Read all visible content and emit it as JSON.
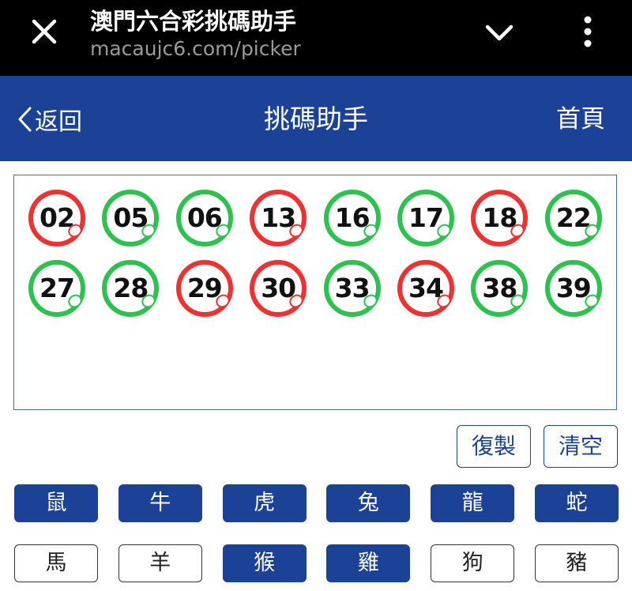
{
  "browser": {
    "title": "澳門六合彩挑碼助手",
    "url": "macaujc6.com/picker",
    "close_icon": "close-icon",
    "dropdown_icon": "chevron-down-icon",
    "menu_icon": "more-vertical-icon"
  },
  "header": {
    "back_label": "返回",
    "title": "挑碼助手",
    "home_label": "首頁",
    "color": "#1b4296"
  },
  "selected_numbers": [
    {
      "num": "02",
      "color": "red"
    },
    {
      "num": "05",
      "color": "green"
    },
    {
      "num": "06",
      "color": "green"
    },
    {
      "num": "13",
      "color": "red"
    },
    {
      "num": "16",
      "color": "green"
    },
    {
      "num": "17",
      "color": "green"
    },
    {
      "num": "18",
      "color": "red"
    },
    {
      "num": "22",
      "color": "green"
    },
    {
      "num": "27",
      "color": "green"
    },
    {
      "num": "28",
      "color": "green"
    },
    {
      "num": "29",
      "color": "red"
    },
    {
      "num": "30",
      "color": "red"
    },
    {
      "num": "33",
      "color": "green"
    },
    {
      "num": "34",
      "color": "red"
    },
    {
      "num": "38",
      "color": "green"
    },
    {
      "num": "39",
      "color": "green"
    }
  ],
  "ball_colors": {
    "red": "#ee3232",
    "green": "#2dc24e"
  },
  "actions": {
    "copy_label": "復製",
    "clear_label": "清空"
  },
  "zodiacs": [
    {
      "label": "鼠",
      "selected": true
    },
    {
      "label": "牛",
      "selected": true
    },
    {
      "label": "虎",
      "selected": true
    },
    {
      "label": "兔",
      "selected": true
    },
    {
      "label": "龍",
      "selected": true
    },
    {
      "label": "蛇",
      "selected": true
    },
    {
      "label": "馬",
      "selected": false
    },
    {
      "label": "羊",
      "selected": false
    },
    {
      "label": "猴",
      "selected": true
    },
    {
      "label": "雞",
      "selected": true
    },
    {
      "label": "狗",
      "selected": false
    },
    {
      "label": "豬",
      "selected": false
    }
  ]
}
